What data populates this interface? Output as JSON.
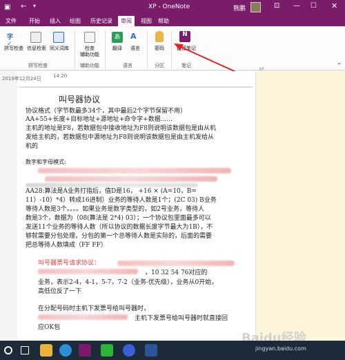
{
  "window": {
    "title": "XP - OneNote",
    "user": "熊鹏"
  },
  "tabs": [
    "文件",
    "开始",
    "插入",
    "绘图",
    "历史记录",
    "审阅",
    "视图",
    "帮助"
  ],
  "ribbon": {
    "btn_spell": "拼写检查",
    "btn_info": "信息检索",
    "btn_thesaurus": "同义词库",
    "btn_access": "检查\n辅助功能",
    "btn_translate": "翻译",
    "btn_language": "语言",
    "btn_password": "密码",
    "btn_linked": "链接笔记",
    "grp_spell": "拼写检查",
    "grp_access": "辅助功能",
    "grp_language": "语言",
    "grp_section": "分区",
    "grp_notes": "笔记"
  },
  "note": {
    "date": "2019年12月24日",
    "time": "14:20",
    "right_label": "XP",
    "title": "叫号器协议",
    "lines": [
      "协议格式（字节数最多34个，其中最后2个字节保留不用）",
      "AA+55+长度+目标地址+源地址+命令字+数据......",
      "主机的地址是F8，若数据包中接收地址为F8则说明该数据包是由从机",
      "发给主机的，若数据包中源地址为F8则说明该数据包是由主机发给从",
      "机的",
      "数字和字母模式:",
      "AA28:算法是A业务打指后，值D是16，    +16 × (A=10，B=",
      "11）-10）*4）转成16进制）业务的等待人数是1个；(2C 03) B业务",
      "等待人数是3个。。。。如果业务是数字类型的，如2号业务，等待人",
      "数是3个，数据为（08(算法是 2*4) 03）；一个协议包里面最多可以",
      "发送11个业务的等待人数（所以协议的数据长度字节最大为1B），不",
      "够就需要分包处理，分包的第一个总等待人数是实际的，后面的需要",
      "把总等待人数填成（FF FF）"
    ],
    "red_line": "叫号器票号请求协议：",
    "lines2": [
      "，10 32 54 76对应的",
      "业务，表示2-4，4-1，5-7，7-2（业务-优先级），业务从0开始，",
      "高低位反了一下",
      "在分配号码时主机下发票号给叫号器时，",
      "主机下发票号给叫号器时就直接回",
      "应OK包"
    ]
  },
  "taskbar": {
    "search_icon": "search-icon"
  },
  "watermark": "Baidu经验",
  "watermark_url": "jingyan.baidu.com",
  "colors": {
    "brand": "#7a1c6a",
    "accent_red": "#d44"
  }
}
